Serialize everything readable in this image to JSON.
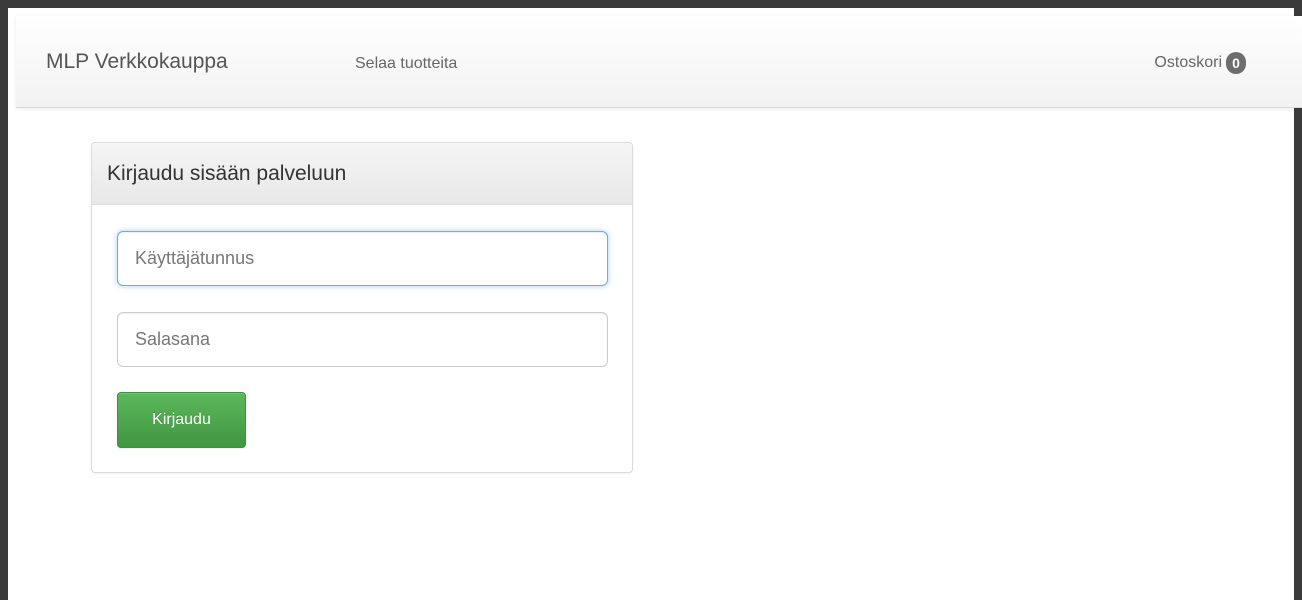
{
  "navbar": {
    "brand": "MLP Verkkokauppa",
    "browse_link": "Selaa tuotteita",
    "cart_label": "Ostoskori",
    "cart_count": "0"
  },
  "login": {
    "title": "Kirjaudu sisään palveluun",
    "username_placeholder": "Käyttäjätunnus",
    "password_placeholder": "Salasana",
    "submit_label": "Kirjaudu"
  },
  "colors": {
    "button_green": "#5cb85c",
    "focus_blue": "#66afe9",
    "badge_gray": "#6d6d6d"
  }
}
